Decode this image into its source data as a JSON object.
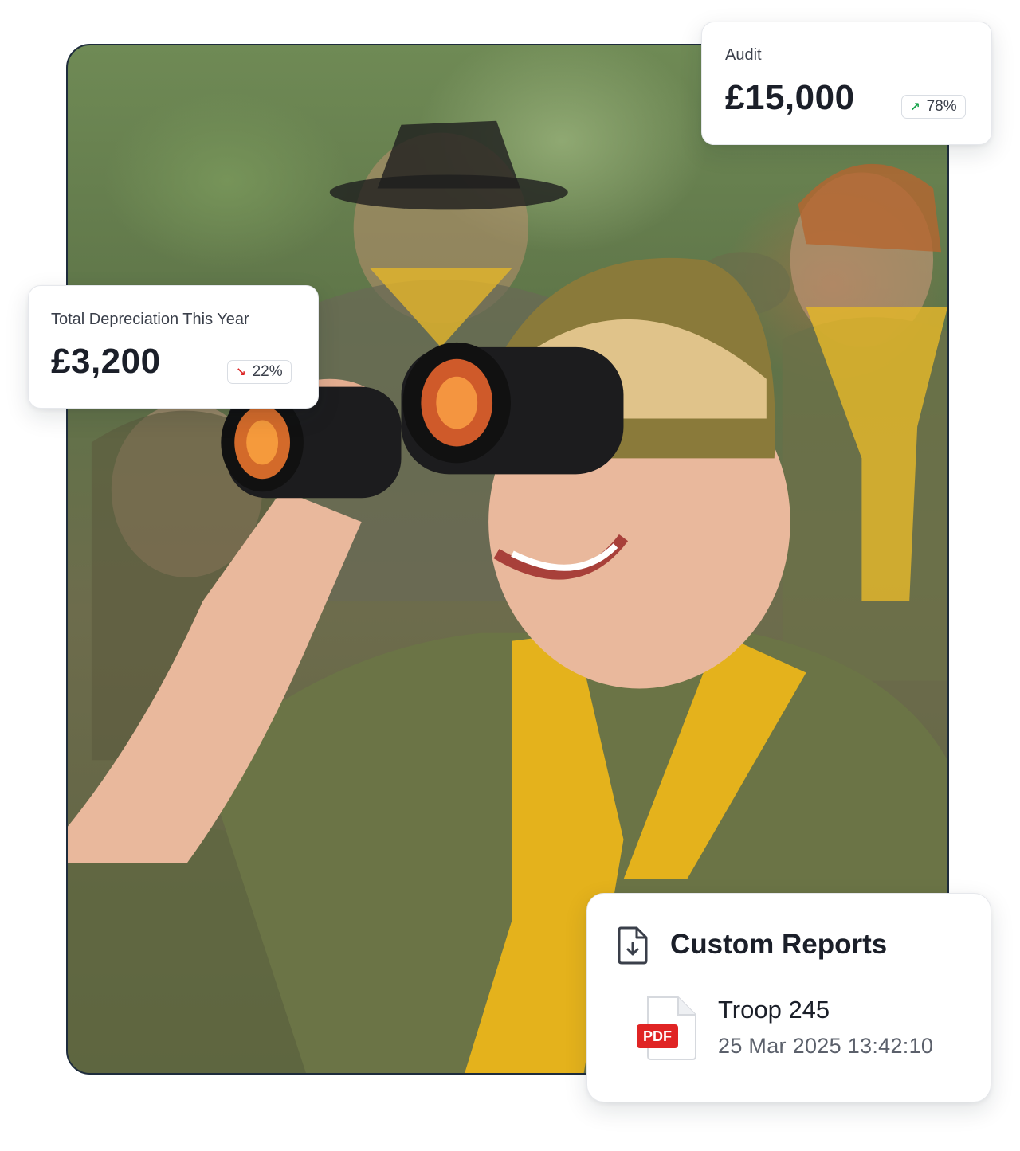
{
  "photo": {
    "description_icon": "scout-with-binoculars-photo"
  },
  "audit_card": {
    "label": "Audit",
    "value": "£15,000",
    "change": "78%",
    "direction": "up",
    "direction_color": "#16a34a"
  },
  "depreciation_card": {
    "label": "Total Depreciation This Year",
    "value": "£3,200",
    "change": "22%",
    "direction": "down",
    "direction_color": "#dc2626"
  },
  "reports_card": {
    "title": "Custom Reports",
    "title_icon": "document-download-icon",
    "file_icon": "pdf-file-icon",
    "file_badge": "PDF",
    "file_name": "Troop 245",
    "file_timestamp": "25 Mar 2025 13:42:10"
  },
  "colors": {
    "frame_border": "#1e2c3c",
    "pdf_red": "#e02424",
    "scarf_yellow": "#e4b21c",
    "uniform_green": "#6b7446"
  }
}
